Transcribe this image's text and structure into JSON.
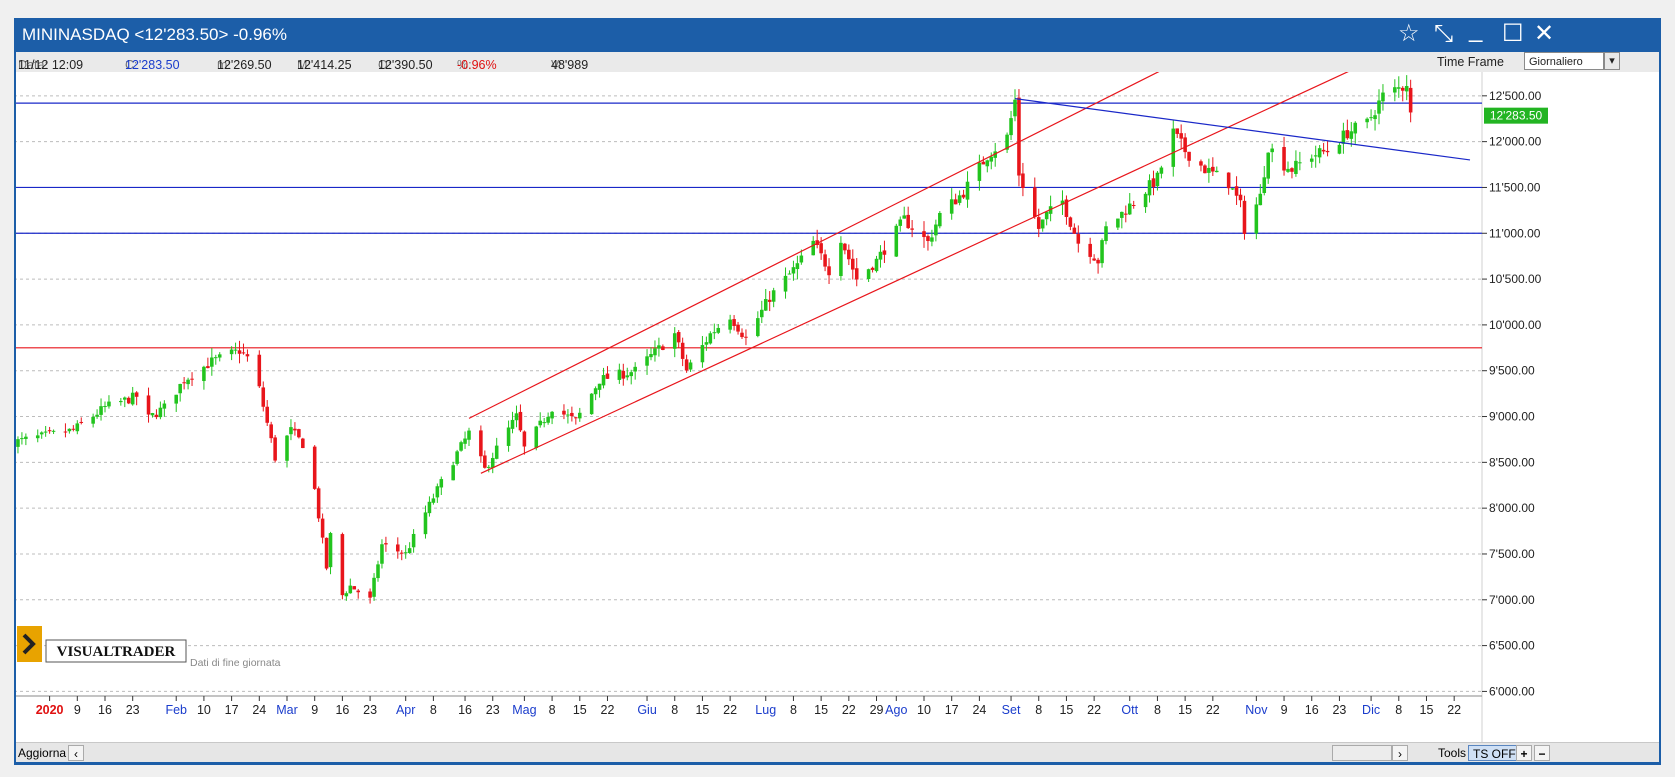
{
  "window": {
    "title": "MININASDAQ <12'283.50> -0.96%",
    "controls": [
      "☆",
      "⤡",
      "_",
      "☐",
      "✕"
    ]
  },
  "infobar": {
    "data_label": "Data:",
    "data_value": "11/12 12:09",
    "c_label": "C:",
    "c_value": "12'283.50",
    "m_label": "m:",
    "m_value": "12'269.50",
    "M_label": "M:",
    "M_value": "12'414.25",
    "o_label": "O:",
    "o_value": "12'390.50",
    "pct_label": "%:",
    "pct_value": "-0.96%",
    "v_label": "V:",
    "v_value": "48'989",
    "timeframe_label": "Time Frame",
    "timeframe_value": "Giornaliero"
  },
  "branding": {
    "logo_text": "VISUALTRADER",
    "note": "Dati di fine giornata"
  },
  "bottombar": {
    "update_label": "Aggiorna",
    "tools_label": "Tools",
    "ts_label": "TS OFF",
    "plus_label": "+",
    "minus_label": "−"
  },
  "colors": {
    "up": "#22c41e",
    "down": "#e8151b",
    "channel": "#e8151b",
    "hline_blue": "#1a28c8",
    "hline_red": "#e8151b",
    "price_tag_bg": "#22b422",
    "grid": "#bcbcbc"
  },
  "chart_data": {
    "type": "candlestick",
    "instrument": "MININASDAQ",
    "timeframe": "Giornaliero",
    "ylim": [
      5950,
      12760
    ],
    "y_ticks": [
      6000,
      6500,
      7000,
      7500,
      8000,
      8500,
      9000,
      9500,
      10000,
      10500,
      11000,
      11500,
      12000,
      12500
    ],
    "y_tick_labels": [
      "6'000.00",
      "6'500.00",
      "7'000.00",
      "7'500.00",
      "8'000.00",
      "8'500.00",
      "9'000.00",
      "9'500.00",
      "10'000.00",
      "10'500.00",
      "11'000.00",
      "11'500.00",
      "12'000.00",
      "12'500.00"
    ],
    "last_price_label": "12'283.50",
    "last_price": 12283.5,
    "x_ticks": [
      {
        "label": "2020",
        "type": "year",
        "date": "2020-01-02"
      },
      {
        "label": "9",
        "type": "day",
        "date": "2020-01-09"
      },
      {
        "label": "16",
        "type": "day",
        "date": "2020-01-16"
      },
      {
        "label": "23",
        "type": "day",
        "date": "2020-01-23"
      },
      {
        "label": "Feb",
        "type": "month",
        "date": "2020-02-03"
      },
      {
        "label": "10",
        "type": "day",
        "date": "2020-02-10"
      },
      {
        "label": "17",
        "type": "day",
        "date": "2020-02-17"
      },
      {
        "label": "24",
        "type": "day",
        "date": "2020-02-24"
      },
      {
        "label": "Mar",
        "type": "month",
        "date": "2020-03-02"
      },
      {
        "label": "9",
        "type": "day",
        "date": "2020-03-09"
      },
      {
        "label": "16",
        "type": "day",
        "date": "2020-03-16"
      },
      {
        "label": "23",
        "type": "day",
        "date": "2020-03-23"
      },
      {
        "label": "Apr",
        "type": "month",
        "date": "2020-04-01"
      },
      {
        "label": "8",
        "type": "day",
        "date": "2020-04-08"
      },
      {
        "label": "16",
        "type": "day",
        "date": "2020-04-16"
      },
      {
        "label": "23",
        "type": "day",
        "date": "2020-04-23"
      },
      {
        "label": "Mag",
        "type": "month",
        "date": "2020-05-01"
      },
      {
        "label": "8",
        "type": "day",
        "date": "2020-05-08"
      },
      {
        "label": "15",
        "type": "day",
        "date": "2020-05-15"
      },
      {
        "label": "22",
        "type": "day",
        "date": "2020-05-22"
      },
      {
        "label": "Giu",
        "type": "month",
        "date": "2020-06-01"
      },
      {
        "label": "8",
        "type": "day",
        "date": "2020-06-08"
      },
      {
        "label": "15",
        "type": "day",
        "date": "2020-06-15"
      },
      {
        "label": "22",
        "type": "day",
        "date": "2020-06-22"
      },
      {
        "label": "Lug",
        "type": "month",
        "date": "2020-07-01"
      },
      {
        "label": "8",
        "type": "day",
        "date": "2020-07-08"
      },
      {
        "label": "15",
        "type": "day",
        "date": "2020-07-15"
      },
      {
        "label": "22",
        "type": "day",
        "date": "2020-07-22"
      },
      {
        "label": "29",
        "type": "day",
        "date": "2020-07-29"
      },
      {
        "label": "Ago",
        "type": "month",
        "date": "2020-08-03"
      },
      {
        "label": "10",
        "type": "day",
        "date": "2020-08-10"
      },
      {
        "label": "17",
        "type": "day",
        "date": "2020-08-17"
      },
      {
        "label": "24",
        "type": "day",
        "date": "2020-08-24"
      },
      {
        "label": "Set",
        "type": "month",
        "date": "2020-09-01"
      },
      {
        "label": "8",
        "type": "day",
        "date": "2020-09-08"
      },
      {
        "label": "15",
        "type": "day",
        "date": "2020-09-15"
      },
      {
        "label": "22",
        "type": "day",
        "date": "2020-09-22"
      },
      {
        "label": "Ott",
        "type": "month",
        "date": "2020-10-01"
      },
      {
        "label": "8",
        "type": "day",
        "date": "2020-10-08"
      },
      {
        "label": "15",
        "type": "day",
        "date": "2020-10-15"
      },
      {
        "label": "22",
        "type": "day",
        "date": "2020-10-22"
      },
      {
        "label": "Nov",
        "type": "month",
        "date": "2020-11-02"
      },
      {
        "label": "9",
        "type": "day",
        "date": "2020-11-09"
      },
      {
        "label": "16",
        "type": "day",
        "date": "2020-11-16"
      },
      {
        "label": "23",
        "type": "day",
        "date": "2020-11-23"
      },
      {
        "label": "Dic",
        "type": "month",
        "date": "2020-12-01"
      },
      {
        "label": "8",
        "type": "day",
        "date": "2020-12-08"
      },
      {
        "label": "15",
        "type": "day",
        "date": "2020-12-15"
      },
      {
        "label": "22",
        "type": "day",
        "date": "2020-12-22"
      }
    ],
    "x_end_date": "2020-12-26",
    "close_path": [
      [
        "2019-12-24",
        8720
      ],
      [
        "2020-01-02",
        8800
      ],
      [
        "2020-01-08",
        8850
      ],
      [
        "2020-01-16",
        9100
      ],
      [
        "2020-01-24",
        9220
      ],
      [
        "2020-01-27",
        8980
      ],
      [
        "2020-01-31",
        9100
      ],
      [
        "2020-02-05",
        9400
      ],
      [
        "2020-02-12",
        9600
      ],
      [
        "2020-02-19",
        9720
      ],
      [
        "2020-02-21",
        9640
      ],
      [
        "2020-02-24",
        9300
      ],
      [
        "2020-02-28",
        8550
      ],
      [
        "2020-03-03",
        8850
      ],
      [
        "2020-03-06",
        8700
      ],
      [
        "2020-03-09",
        8200
      ],
      [
        "2020-03-12",
        7350
      ],
      [
        "2020-03-13",
        7700
      ],
      [
        "2020-03-16",
        7050
      ],
      [
        "2020-03-18",
        7150
      ],
      [
        "2020-03-23",
        7000
      ],
      [
        "2020-03-26",
        7600
      ],
      [
        "2020-04-01",
        7500
      ],
      [
        "2020-04-06",
        7950
      ],
      [
        "2020-04-09",
        8200
      ],
      [
        "2020-04-14",
        8600
      ],
      [
        "2020-04-17",
        8820
      ],
      [
        "2020-04-21",
        8420
      ],
      [
        "2020-04-24",
        8650
      ],
      [
        "2020-04-29",
        9000
      ],
      [
        "2020-05-01",
        8650
      ],
      [
        "2020-05-08",
        9100
      ],
      [
        "2020-05-14",
        8950
      ],
      [
        "2020-05-20",
        9400
      ],
      [
        "2020-05-29",
        9500
      ],
      [
        "2020-06-08",
        9900
      ],
      [
        "2020-06-11",
        9500
      ],
      [
        "2020-06-17",
        9900
      ],
      [
        "2020-06-22",
        10100
      ],
      [
        "2020-06-26",
        9850
      ],
      [
        "2020-07-02",
        10300
      ],
      [
        "2020-07-09",
        10650
      ],
      [
        "2020-07-13",
        10900
      ],
      [
        "2020-07-17",
        10600
      ],
      [
        "2020-07-20",
        10950
      ],
      [
        "2020-07-24",
        10500
      ],
      [
        "2020-07-29",
        10700
      ],
      [
        "2020-08-05",
        11150
      ],
      [
        "2020-08-11",
        10900
      ],
      [
        "2020-08-14",
        11200
      ],
      [
        "2020-08-20",
        11450
      ],
      [
        "2020-08-26",
        11850
      ],
      [
        "2020-08-31",
        12050
      ],
      [
        "2020-09-02",
        12450
      ],
      [
        "2020-09-03",
        11650
      ],
      [
        "2020-09-08",
        11050
      ],
      [
        "2020-09-10",
        11200
      ],
      [
        "2020-09-14",
        11350
      ],
      [
        "2020-09-18",
        10900
      ],
      [
        "2020-09-21",
        10800
      ],
      [
        "2020-09-23",
        10700
      ],
      [
        "2020-09-25",
        11050
      ],
      [
        "2020-10-01",
        11300
      ],
      [
        "2020-10-08",
        11600
      ],
      [
        "2020-10-12",
        12100
      ],
      [
        "2020-10-15",
        11900
      ],
      [
        "2020-10-20",
        11700
      ],
      [
        "2020-10-26",
        11550
      ],
      [
        "2020-10-29",
        11300
      ],
      [
        "2020-10-30",
        11050
      ],
      [
        "2020-11-03",
        11400
      ],
      [
        "2020-11-05",
        11950
      ],
      [
        "2020-11-09",
        11750
      ],
      [
        "2020-11-11",
        11700
      ],
      [
        "2020-11-16",
        11850
      ],
      [
        "2020-11-20",
        11900
      ],
      [
        "2020-11-25",
        12100
      ],
      [
        "2020-11-30",
        12200
      ],
      [
        "2020-12-04",
        12500
      ],
      [
        "2020-12-09",
        12600
      ],
      [
        "2020-12-10",
        12650
      ],
      [
        "2020-12-11",
        12283
      ]
    ],
    "hlines": [
      {
        "y": 12420,
        "color": "blue"
      },
      {
        "y": 11500,
        "color": "blue"
      },
      {
        "y": 11000,
        "color": "blue"
      },
      {
        "y": 9750,
        "color": "red"
      }
    ],
    "trendlines": [
      {
        "from": [
          "2020-04-17",
          8980
        ],
        "to": [
          "2020-10-10",
          12800
        ],
        "color": "red"
      },
      {
        "from": [
          "2020-04-20",
          8380
        ],
        "to": [
          "2020-11-27",
          12800
        ],
        "color": "red"
      },
      {
        "from": [
          "2020-09-02",
          12470
        ],
        "to": [
          "2020-12-26",
          11800
        ],
        "color": "blue"
      }
    ]
  }
}
